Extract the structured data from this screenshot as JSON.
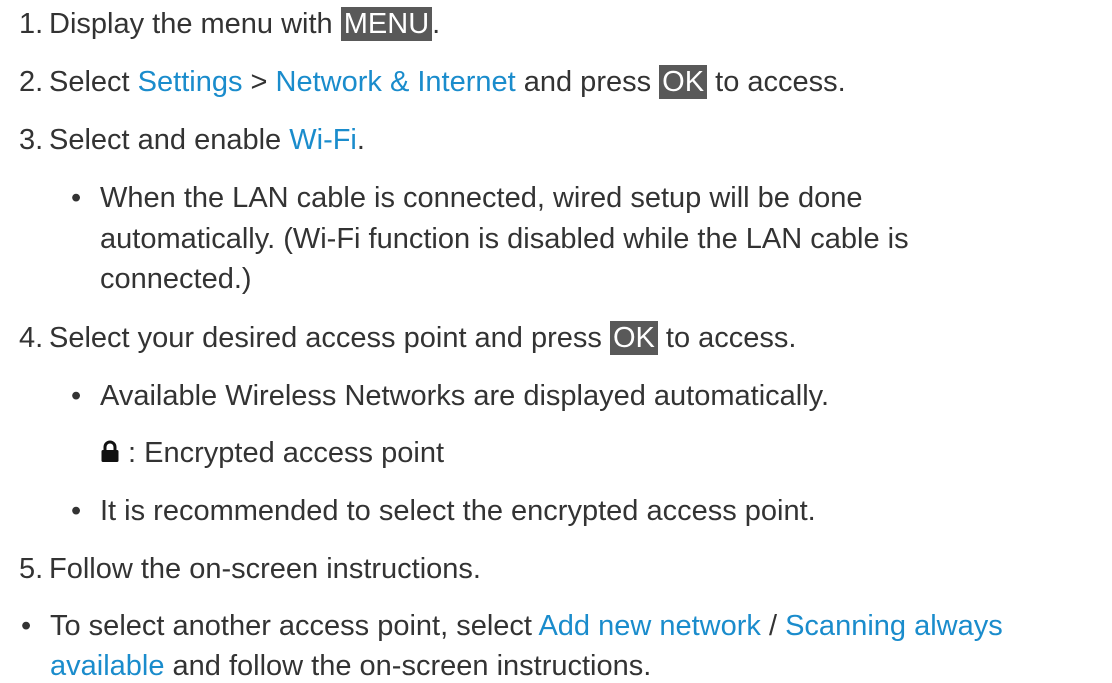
{
  "steps": {
    "s1": {
      "num": "1.",
      "text": "Display the menu with ",
      "key": "MENU",
      "after": "."
    },
    "s2": {
      "num": "2.",
      "pre": "Select ",
      "link1": "Settings",
      "sep": " > ",
      "link2": "Network & Internet",
      "mid": " and press ",
      "key": "OK",
      "after": " to access."
    },
    "s3": {
      "num": "3.",
      "pre": "Select and enable ",
      "link": "Wi-Fi",
      "after": ".",
      "bullet": {
        "line1": "When the LAN cable is connected, wired setup will be done",
        "line2": "automatically. (Wi-Fi function is disabled while the LAN cable is",
        "line3": "connected.)"
      }
    },
    "s4": {
      "num": "4.",
      "pre": "Select your desired access point and press ",
      "key": "OK",
      "after": " to access.",
      "bullet1": "Available Wireless Networks are displayed automatically.",
      "lock_icon": "lock-icon",
      "lock_text": " : Encrypted access point",
      "bullet2": "It is recommended to select the encrypted access point."
    },
    "s5": {
      "num": "5.",
      "text": "Follow the on-screen instructions."
    }
  },
  "note": {
    "pre": "To select another access point, select ",
    "link1": "Add new network",
    "sep": " / ",
    "link2_line1": "Scanning always",
    "link2_line2": "available",
    "after": " and follow the on-screen instructions."
  },
  "colors": {
    "link": "#1a8ccc",
    "key_bg": "#595959",
    "text": "#333333"
  }
}
